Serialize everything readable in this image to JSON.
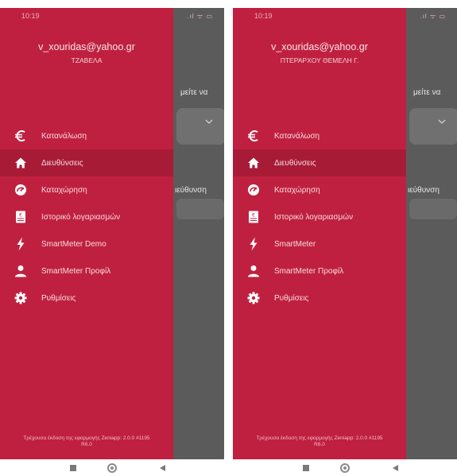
{
  "screens": [
    {
      "status": {
        "time": "10:19",
        "icons": ".ıl ᯤ ▭"
      },
      "user": {
        "email": "v_xouridas@yahoo.gr",
        "name": "ΤΖΑΒΕΛΑ"
      },
      "background": {
        "text_1": "μείτε να",
        "text_2": "ιεύθυνση"
      },
      "menu": [
        {
          "label": "Κατανάλωση",
          "icon": "euro-icon"
        },
        {
          "label": "Διευθύνσεις",
          "icon": "home-icon"
        },
        {
          "label": "Καταχώρηση",
          "icon": "gauge-icon"
        },
        {
          "label": "Ιστορικό λογαριασμών",
          "icon": "bill-icon"
        },
        {
          "label": "SmartMeter Demo",
          "icon": "bolt-icon"
        },
        {
          "label": "SmartMeter Προφίλ",
          "icon": "person-icon"
        },
        {
          "label": "Ρυθμίσεις",
          "icon": "gear-icon"
        }
      ],
      "active_index": 1,
      "footer": {
        "line1": "Τρέχουσα έκδοση της εφαρμογής Zeniapp: 2.0.0 #1195",
        "line2": "R6.0"
      }
    },
    {
      "status": {
        "time": "10:19",
        "icons": ".ıl ᯤ ▭"
      },
      "user": {
        "email": "v_xouridas@yahoo.gr",
        "name": "ΠΤΕΡΑΡΧΟΥ ΘΕΜΕΛΗ Γ."
      },
      "background": {
        "text_1": "μείτε να",
        "text_2": "ιεύθυνση"
      },
      "menu": [
        {
          "label": "Κατανάλωση",
          "icon": "euro-icon"
        },
        {
          "label": "Διευθύνσεις",
          "icon": "home-icon"
        },
        {
          "label": "Καταχώρηση",
          "icon": "gauge-icon"
        },
        {
          "label": "Ιστορικό λογαριασμών",
          "icon": "bill-icon"
        },
        {
          "label": "SmartMeter",
          "icon": "bolt-icon"
        },
        {
          "label": "SmartMeter Προφίλ",
          "icon": "person-icon"
        },
        {
          "label": "Ρυθμίσεις",
          "icon": "gear-icon"
        }
      ],
      "active_index": 1,
      "footer": {
        "line1": "Τρέχουσα έκδοση της εφαρμογής Zeniapp: 2.0.0 #1195",
        "line2": "R6.0"
      }
    }
  ],
  "colors": {
    "drawer": "#c0203f",
    "active_item": "#a81b36",
    "scrim": "#5b5b5b"
  }
}
